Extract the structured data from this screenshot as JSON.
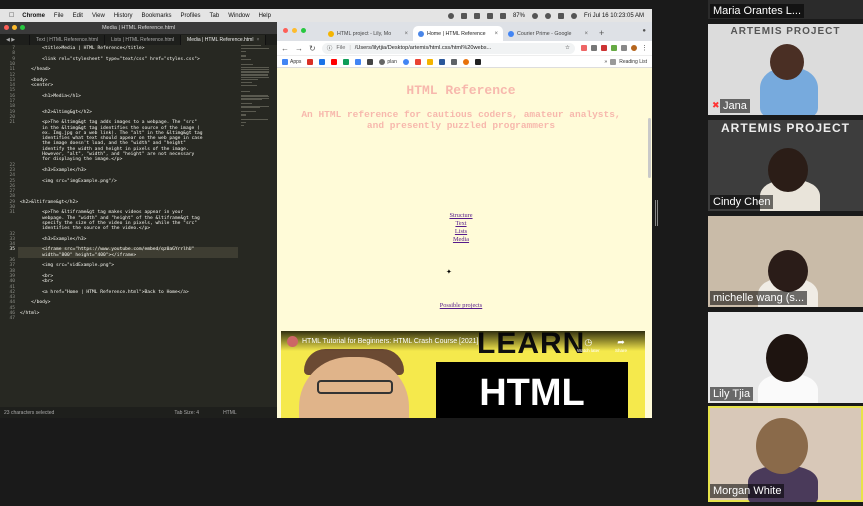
{
  "menubar": {
    "apple": "",
    "items": [
      "Chrome",
      "File",
      "Edit",
      "View",
      "History",
      "Bookmarks",
      "Profiles",
      "Tab",
      "Window",
      "Help"
    ],
    "battery": "87%",
    "clock": "Fri Jul 16  10:23:05 AM"
  },
  "editor": {
    "window_title": "Media | HTML Reference.html",
    "tabs": [
      {
        "label": "Text | HTML Reference.html",
        "active": false
      },
      {
        "label": "Lists | HTML Reference.html",
        "active": false
      },
      {
        "label": "Media | HTML Reference.html",
        "active": true
      }
    ],
    "status": {
      "selection": "23 characters selected",
      "tab_size": "Tab Size: 4",
      "language": "HTML"
    },
    "line_numbers": [
      "7",
      "8",
      "9",
      "10",
      "11",
      "12",
      "13",
      "14",
      "15",
      "16",
      "17",
      "18",
      "19",
      "20",
      "21",
      "",
      "",
      "",
      "",
      "",
      "",
      "",
      "22",
      "23",
      "24",
      "25",
      "26",
      "27",
      "28",
      "29",
      "30",
      "31",
      "",
      "",
      "",
      "32",
      "33",
      "34",
      "35",
      "",
      "36",
      "37",
      "38",
      "39",
      "40",
      "41",
      "42",
      "43",
      "44",
      "45",
      "46",
      "47"
    ],
    "code_lines": [
      "        <title>Media | HTML Reference</title>",
      "",
      "        <link rel=\"stylesheet\" type=\"text/css\" href=\"styles.css\">",
      "",
      "    </head>",
      "",
      "    <body>",
      "    <center>",
      "",
      "        <h1>Media</h1>",
      "",
      "",
      "        <h2>&ltimg&gt</h2>",
      "",
      "        <p>The &ltimg&gt tag adds images to a webpage. The \"src\"",
      "        in the &ltimg&gt tag identifies the source of the image (",
      "        ex. Img.jpg or a web link). The \"alt\" in the &ltimg&gt tag",
      "        identifies what text should appear on the web page in case",
      "        the image doesn't load, and the \"width\" and \"height\"",
      "        identify the width and height in pixels of the image.",
      "        However, \"alt\", \"width\", and \"height\" are not necessary",
      "        for displaying the image.</p>",
      "",
      "        <h3>Example</h3>",
      "",
      "        <img src=\"imgExample.png\"/>",
      "",
      "",
      "",
      "<h2>&ltiframe&gt</h2>",
      "",
      "        <p>The &ltiframe&gt tag makes videos appear in your",
      "        webpage. The \"width\" and \"height\" of the &ltiframe&gt tag",
      "        specify the size of the video in pixels, while the \"src\"",
      "        identifies the source of the video.</p>",
      "",
      "        <h3>Example</h3>",
      "",
      "        <iframe src=\"https://www.youtube.com/embed/qz0aGYrrlhU\"",
      "        width=\"800\" height=\"400\"></iframe>",
      "",
      "        <img src=\"vidExample.png\">",
      "",
      "        <br>",
      "        <br>",
      "",
      "        <a href=\"Home | HTML Reference.html\">Back to Home</a>",
      "",
      "    </body>",
      "",
      "</html>",
      ""
    ]
  },
  "browser": {
    "tabs": [
      {
        "label": "HTML project - Lily, Mo",
        "active": false,
        "icon": "drive-icon"
      },
      {
        "label": "Home | HTML Reference",
        "active": true,
        "icon": "globe-icon"
      },
      {
        "label": "Courier Prime - Google",
        "active": false,
        "icon": "google-fonts-icon"
      }
    ],
    "address": {
      "scheme": "File",
      "path": "/Users/lilytjia/Desktop/artemis/html.css/html%20webs..."
    },
    "bookmarks": [
      "Apps",
      "plan",
      "Reading List"
    ],
    "page": {
      "title": "HTML Reference",
      "subtitle": "An HTML reference for cautious coders, amateur analysts, and presently puzzled programmers",
      "links": [
        "Structure",
        "Text",
        "Lists",
        "Media"
      ],
      "extra_link": "Possible projects",
      "video": {
        "title": "HTML Tutorial for Beginners: HTML Crash Course [2021]",
        "thumb_top": "LEARN",
        "thumb_main": "HTML",
        "watch_later": "Watch later",
        "share": "Share"
      }
    }
  },
  "participants": [
    {
      "name": "Maria Orantes L...",
      "muted": false,
      "banner": ""
    },
    {
      "name": "Jana",
      "muted": true,
      "banner": "ARTEMIS PROJECT"
    },
    {
      "name": "Cindy Chen",
      "muted": false,
      "banner": "ARTEMIS PROJECT"
    },
    {
      "name": "michelle wang (s...",
      "muted": false,
      "banner": ""
    },
    {
      "name": "Lily Tjia",
      "muted": false,
      "banner": ""
    },
    {
      "name": "Morgan White",
      "muted": false,
      "banner": "",
      "speaking": true
    }
  ],
  "colors": {
    "page_bg": "#fffbd8",
    "heading": "#f7b8ad",
    "link": "#551a8b",
    "editor_bg": "#272822",
    "speaker_outline": "#e7e34a"
  }
}
